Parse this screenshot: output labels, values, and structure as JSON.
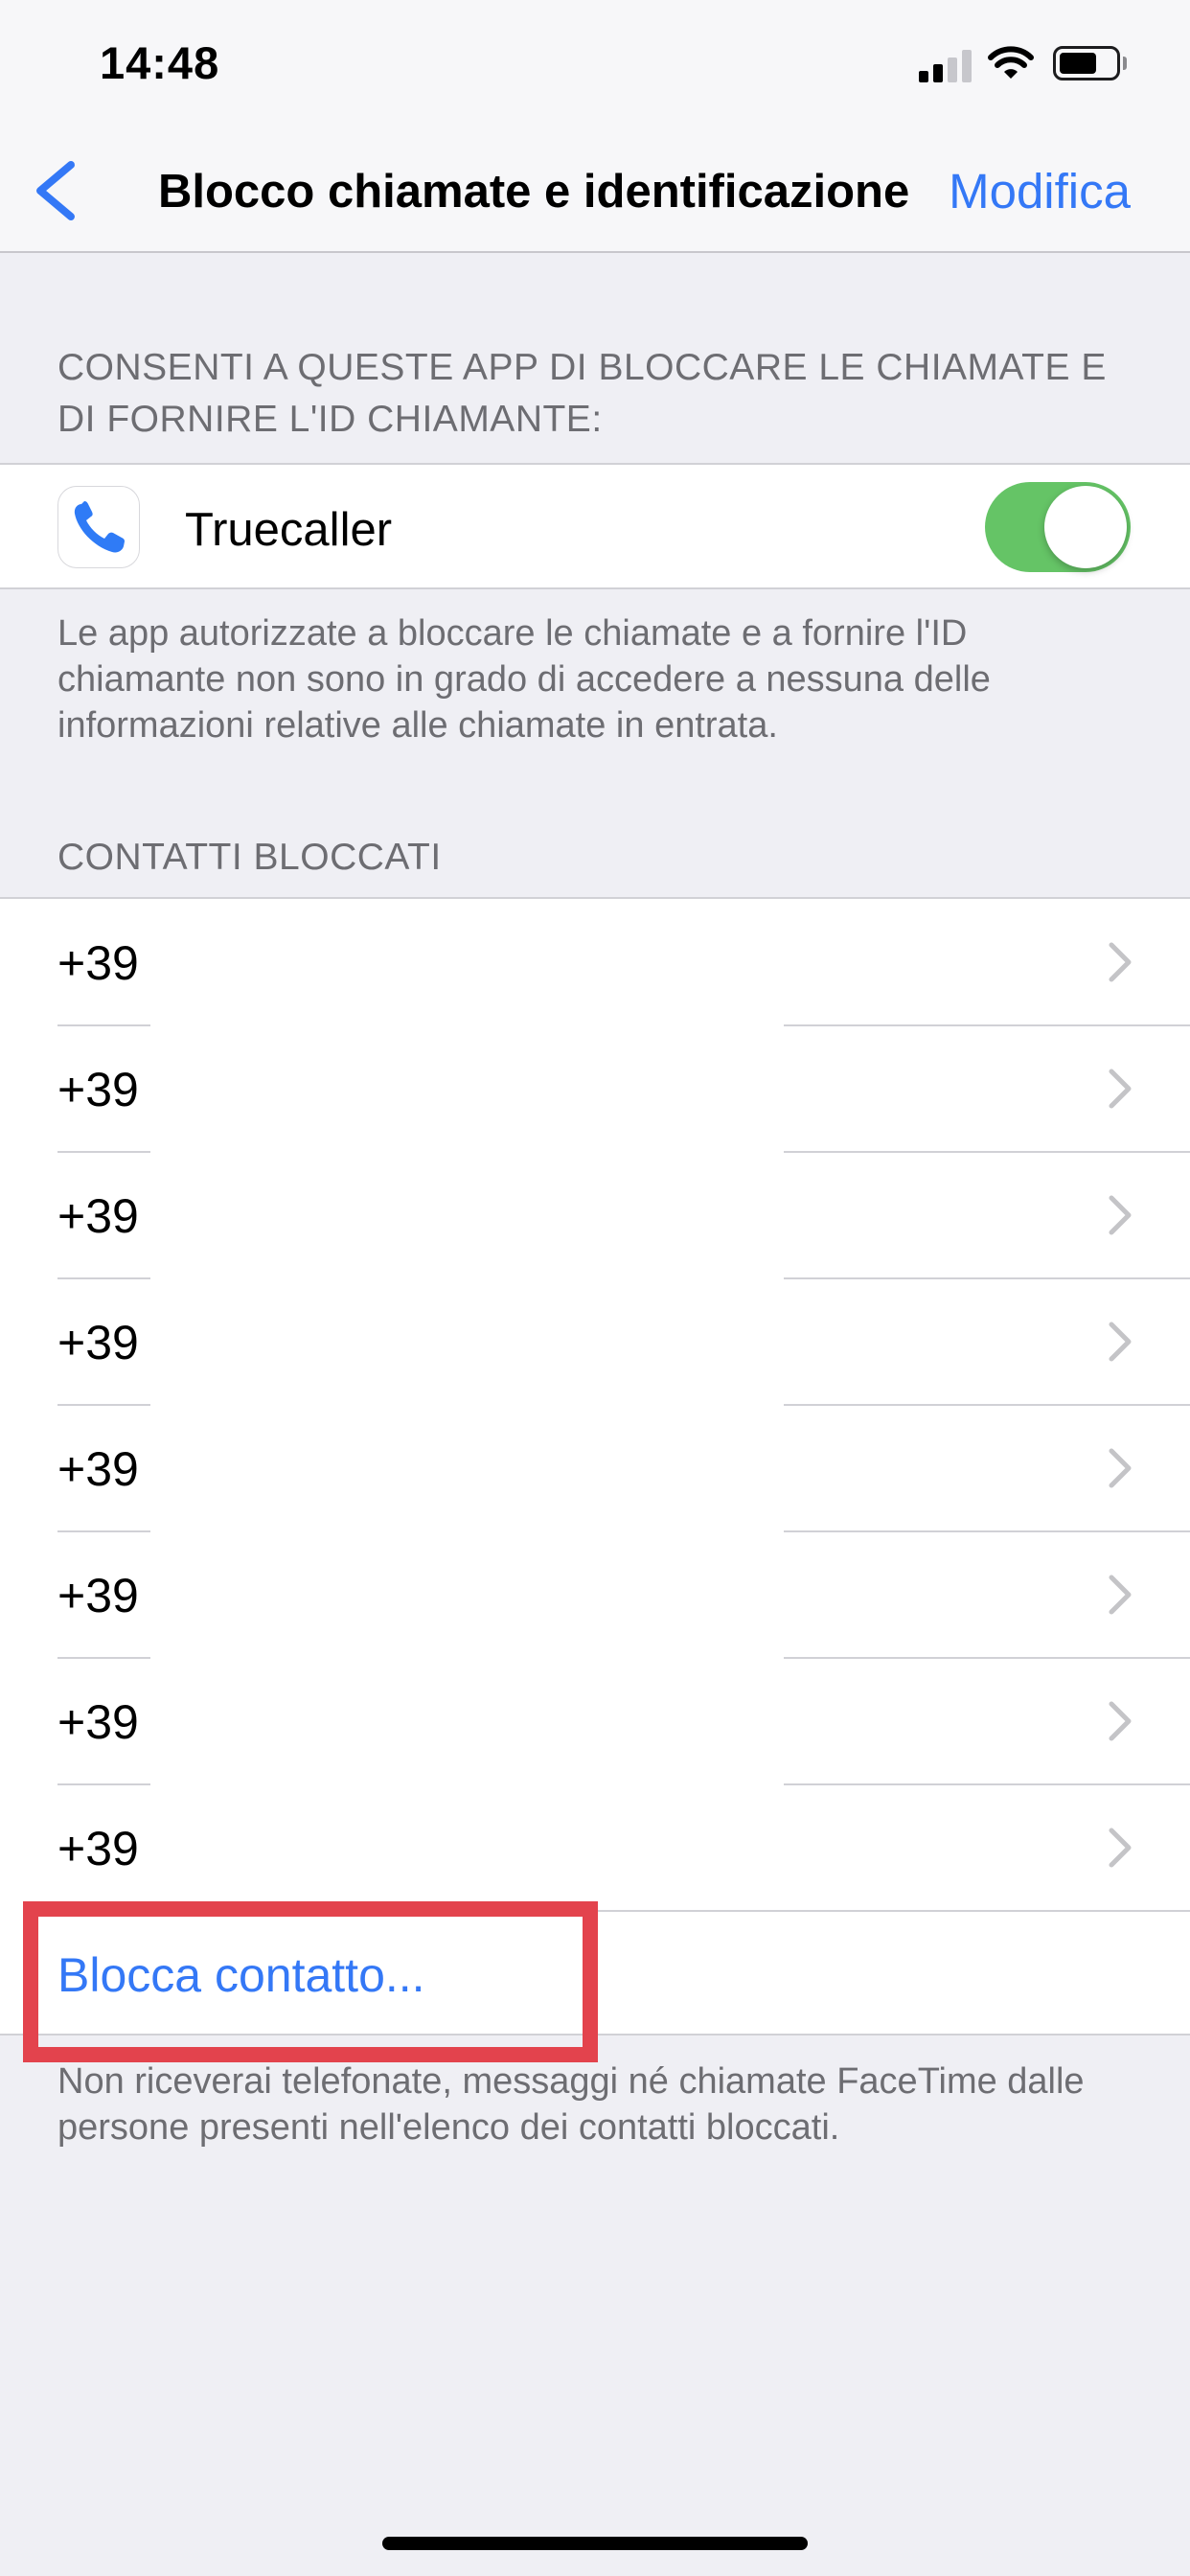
{
  "status_bar": {
    "time": "14:48"
  },
  "nav": {
    "title": "Blocco chiamate e identificazione",
    "edit_label": "Modifica"
  },
  "apps_section": {
    "header": "CONSENTI A QUESTE APP DI BLOCCARE LE CHIAMATE E DI FORNIRE L'ID CHIAMANTE:",
    "app": {
      "name": "Truecaller",
      "enabled": true
    },
    "footer": "Le app autorizzate a bloccare le chiamate e a fornire l'ID chiamante non sono in grado di accedere a nessuna delle informazioni relative alle chiamate in entrata."
  },
  "blocked_section": {
    "header": "CONTATTI BLOCCATI",
    "contacts": [
      "+39",
      "+39",
      "+39",
      "+39",
      "+39",
      "+39",
      "+39",
      "+39"
    ],
    "block_action": "Blocca contatto...",
    "footer": "Non riceverai telefonate, messaggi né chiamate FaceTime dalle persone presenti nell'elenco dei contatti bloccati."
  },
  "colors": {
    "accent": "#3478f6",
    "toggle_on": "#65c466",
    "highlight": "#e3434d",
    "background": "#efeff4"
  }
}
